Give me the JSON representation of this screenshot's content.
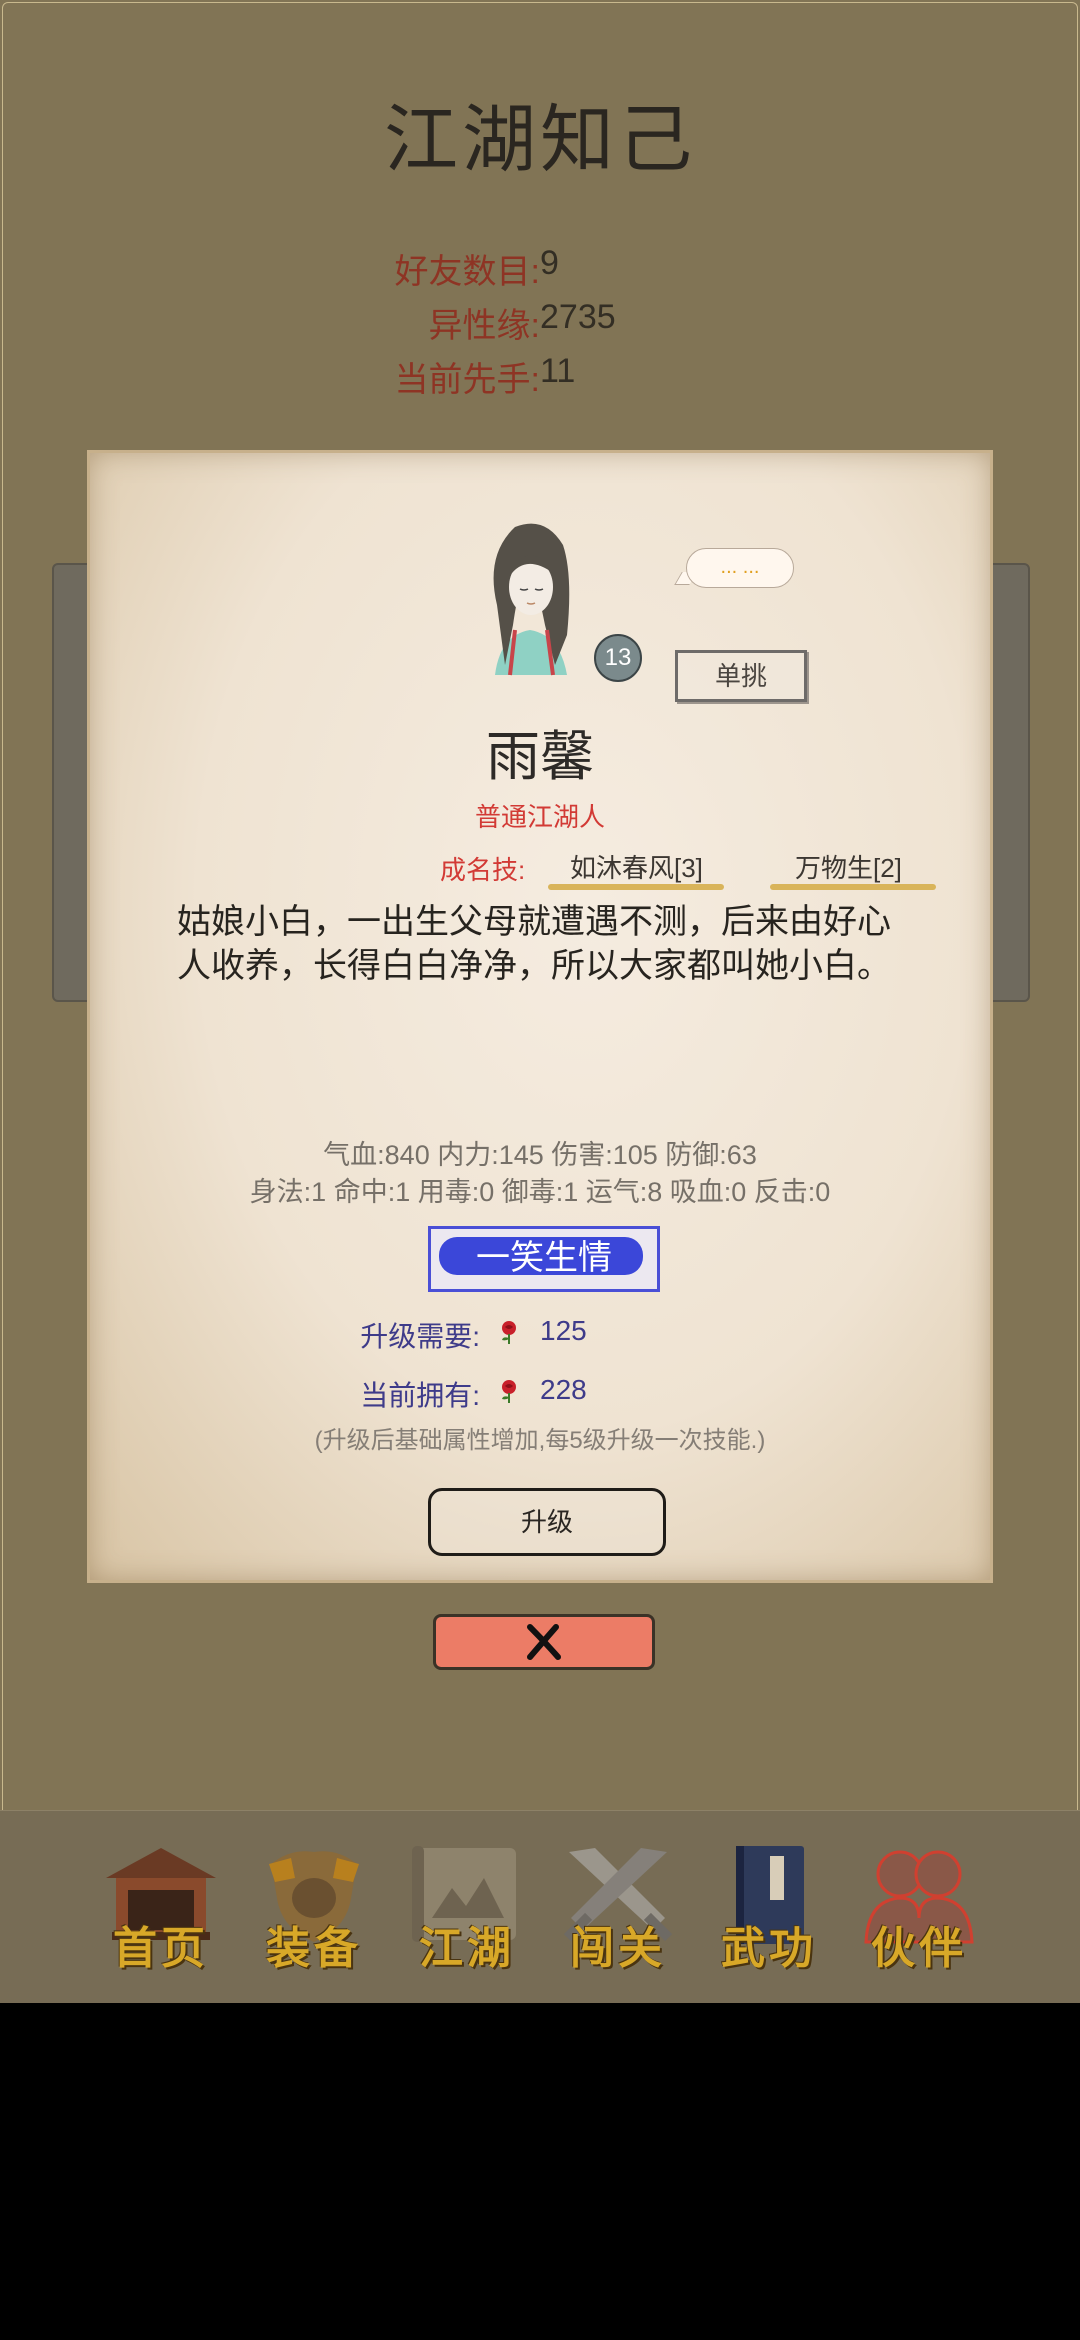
{
  "page": {
    "title": "江湖知己"
  },
  "stats": [
    {
      "label": "好友数目:",
      "value": "9"
    },
    {
      "label": "异性缘:",
      "value": "2735"
    },
    {
      "label": "当前先手:",
      "value": "11"
    }
  ],
  "character": {
    "level": "13",
    "speech": "... ...",
    "duel_label": "单挑",
    "name": "雨馨",
    "rank": "普通江湖人",
    "signature_label": "成名技:",
    "skills": [
      "如沐春风[3]",
      "万物生[2]"
    ],
    "description": "姑娘小白，一出生父母就遭遇不测，后来由好心人收养，长得白白净净，所以大家都叫她小白。",
    "attributes_line1": "气血:840  内力:145  伤害:105  防御:63",
    "attributes_line2": "身法:1  命中:1  用毒:0  御毒:1  运气:8  吸血:0  反击:0",
    "skill_button": "一笑生情",
    "upgrade_need_label": "升级需要:",
    "upgrade_need_value": "125",
    "current_have_label": "当前拥有:",
    "current_have_value": "228",
    "note": "(升级后基础属性增加,每5级升级一次技能.)",
    "upgrade_button": "升级"
  },
  "close_icon": "close-x-icon",
  "nav": [
    {
      "label": "首页",
      "icon": "house-icon"
    },
    {
      "label": "装备",
      "icon": "armor-icon"
    },
    {
      "label": "江湖",
      "icon": "scroll-map-icon"
    },
    {
      "label": "闯关",
      "icon": "crossed-swords-icon"
    },
    {
      "label": "武功",
      "icon": "book-icon"
    },
    {
      "label": "伙伴",
      "icon": "partners-icon",
      "active": true
    }
  ],
  "colors": {
    "background": "#817455",
    "accent_red": "#d23a35",
    "skill_blue": "#3b47d9",
    "close_red": "#ec7c66",
    "nav_gold": "#d8a828"
  }
}
